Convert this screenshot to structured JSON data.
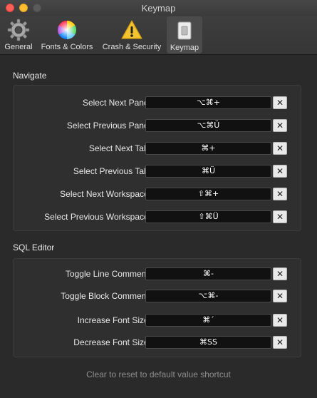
{
  "window": {
    "title": "Keymap"
  },
  "toolbar": {
    "tabs": [
      {
        "label": "General",
        "icon": "gear-icon"
      },
      {
        "label": "Fonts & Colors",
        "icon": "color-wheel-icon"
      },
      {
        "label": "Crash & Security",
        "icon": "warning-icon"
      },
      {
        "label": "Keymap",
        "icon": "keymap-icon",
        "active": true
      }
    ]
  },
  "navigate": {
    "title": "Navigate",
    "rows": [
      {
        "label": "Select Next Pane:",
        "shortcut": "⌥⌘+"
      },
      {
        "label": "Select Previous Pane:",
        "shortcut": "⌥⌘Ü"
      },
      {
        "label": "Select Next Tab:",
        "shortcut": "⌘+"
      },
      {
        "label": "Select Previous Tab:",
        "shortcut": "⌘Ü"
      },
      {
        "label": "Select Next Workspace:",
        "shortcut": "⇧⌘+"
      },
      {
        "label": "Select Previous Workspace:",
        "shortcut": "⇧⌘Ü"
      }
    ]
  },
  "sql_editor": {
    "title": "SQL Editor",
    "rows": [
      {
        "label": "Toggle Line Comment:",
        "shortcut": "⌘-"
      },
      {
        "label": "Toggle Block Comment:",
        "shortcut": "⌥⌘-"
      },
      {
        "label": "Increase Font Size:",
        "shortcut": "⌘´"
      },
      {
        "label": "Decrease Font Size:",
        "shortcut": "⌘SS"
      }
    ]
  },
  "clear_button_label": "✕",
  "footer": {
    "hint": "Clear to reset to default value shortcut"
  },
  "colors": {
    "accent": "#4b4b4b",
    "background": "#2a2a2a",
    "field": "#111111"
  }
}
